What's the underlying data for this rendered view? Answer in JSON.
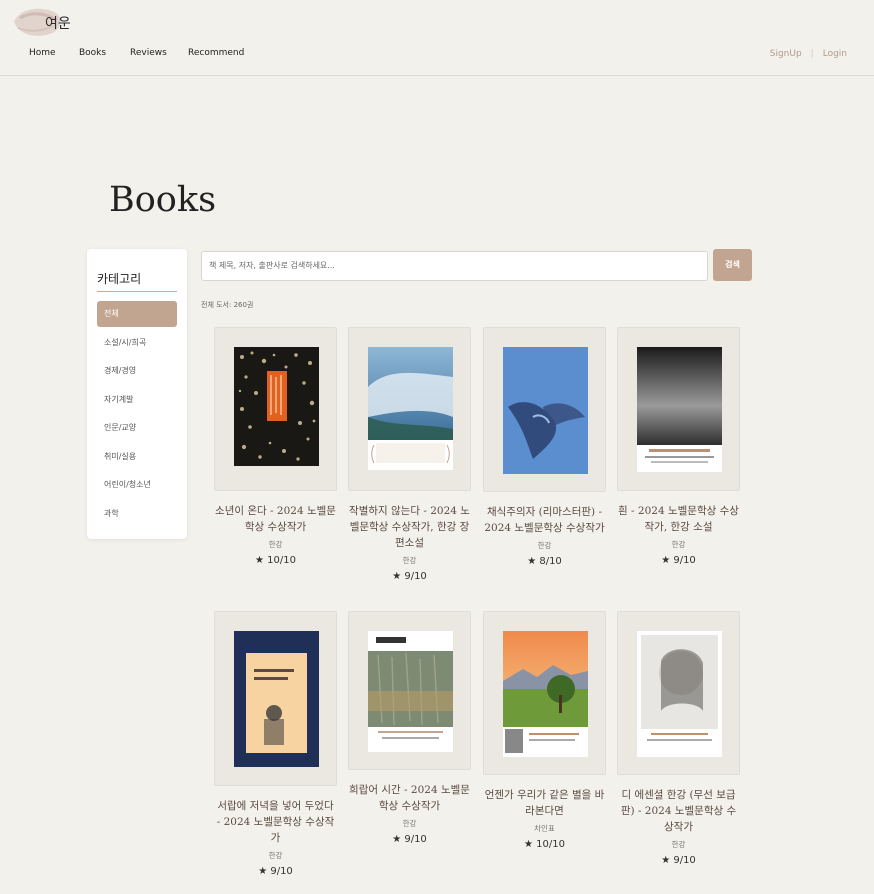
{
  "brand": {
    "logo_text": "여운"
  },
  "nav": {
    "items": [
      "Home",
      "Books",
      "Reviews",
      "Recommend"
    ],
    "signup": "SignUp",
    "separator": "|",
    "login": "Login"
  },
  "page_title": "Books",
  "sidebar": {
    "title": "카테고리",
    "categories": [
      "전체",
      "소설/시/희곡",
      "경제/경영",
      "자기계발",
      "인문/교양",
      "취미/실용",
      "어린이/청소년",
      "과학"
    ],
    "active_index": 0
  },
  "search": {
    "placeholder": "책 제목, 저자, 출판사로 검색하세요...",
    "button": "검색"
  },
  "total_label": "전체 도서: 260권",
  "books": [
    {
      "title": "소년이 온다 - 2024 노벨문학상 수상작가",
      "author": "한강",
      "rating": "★ 10/10",
      "cover": "cover-sonyeon"
    },
    {
      "title": "작별하지 않는다 - 2024 노벨문학상 수상작가, 한강 장편소설",
      "author": "한강",
      "rating": "★ 9/10",
      "cover": "cover-jakbyeol"
    },
    {
      "title": "채식주의자 (리마스터판) - 2024 노벨문학상 수상작가",
      "author": "한강",
      "rating": "★ 8/10",
      "cover": "cover-chaesik"
    },
    {
      "title": "흰 - 2024 노벨문학상 수상작가, 한강 소설",
      "author": "한강",
      "rating": "★ 9/10",
      "cover": "cover-huin"
    },
    {
      "title": "서랍에 저녁을 넣어 두었다 - 2024 노벨문학상 수상작가",
      "author": "한강",
      "rating": "★ 9/10",
      "cover": "cover-seorap"
    },
    {
      "title": "희랍어 시간 - 2024 노벨문학상 수상작가",
      "author": "한강",
      "rating": "★ 9/10",
      "cover": "cover-hirap"
    },
    {
      "title": "언젠가 우리가 같은 별을 바라본다면",
      "author": "차인표",
      "rating": "★ 10/10",
      "cover": "cover-eonjenga"
    },
    {
      "title": "디 에센셜 한강 (무선 보급판) - 2024 노벨문학상 수상작가",
      "author": "한강",
      "rating": "★ 9/10",
      "cover": "cover-essential"
    }
  ],
  "colors": {
    "accent": "#c2a590",
    "background": "#f3f1ec",
    "title_text": "#5a4a3f"
  }
}
